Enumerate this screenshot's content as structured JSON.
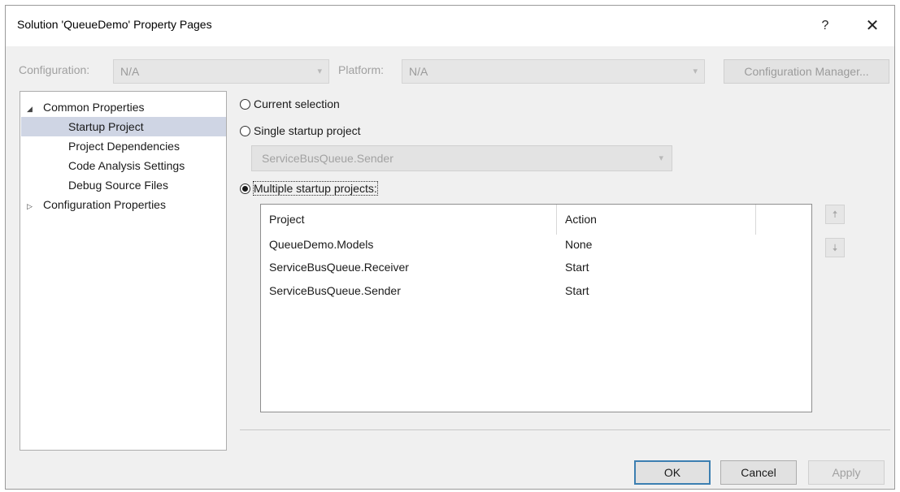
{
  "window": {
    "title": "Solution 'QueueDemo' Property Pages",
    "help_label": "?",
    "close_label": "✕"
  },
  "config_bar": {
    "configuration_label": "Configuration:",
    "configuration_value": "N/A",
    "platform_label": "Platform:",
    "platform_value": "N/A",
    "configuration_manager_label": "Configuration Manager..."
  },
  "tree": {
    "items": [
      {
        "label": "Common Properties",
        "expander": "◢"
      },
      {
        "label": "Startup Project"
      },
      {
        "label": "Project Dependencies"
      },
      {
        "label": "Code Analysis Settings"
      },
      {
        "label": "Debug Source Files"
      },
      {
        "label": "Configuration Properties",
        "expander": "▷"
      }
    ]
  },
  "startup": {
    "current_selection_label": "Current selection",
    "single_startup_label": "Single startup project",
    "single_startup_value": "ServiceBusQueue.Sender",
    "multiple_startup_label": "Multiple startup projects:",
    "selected_option": "multiple"
  },
  "grid": {
    "headers": [
      "Project",
      "Action"
    ],
    "rows": [
      {
        "project": "QueueDemo.Models",
        "action": "None"
      },
      {
        "project": "ServiceBusQueue.Receiver",
        "action": "Start"
      },
      {
        "project": "ServiceBusQueue.Sender",
        "action": "Start"
      }
    ],
    "move_up_icon": "arrow-up-icon",
    "move_down_icon": "arrow-down-icon"
  },
  "buttons": {
    "ok": "OK",
    "cancel": "Cancel",
    "apply": "Apply"
  },
  "colors": {
    "selection": "#cfd5e4",
    "default_button_border": "#3c7fb1"
  }
}
